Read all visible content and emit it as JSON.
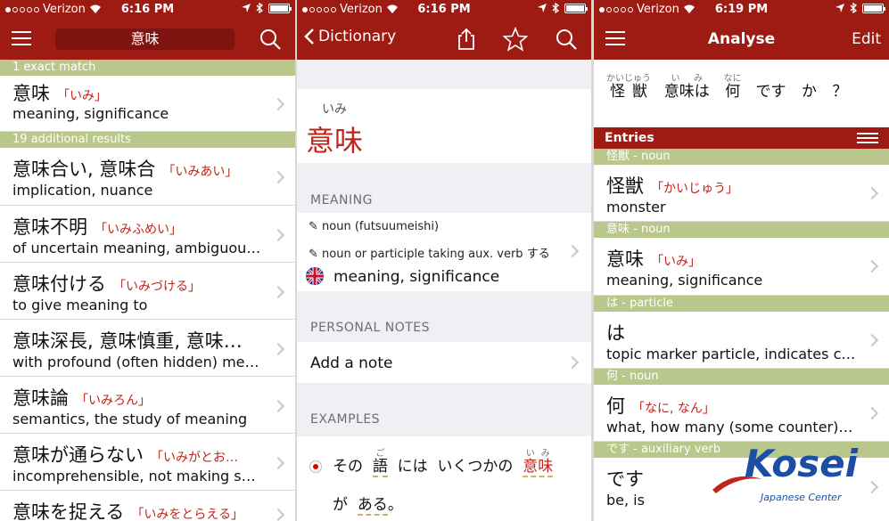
{
  "status_bars": [
    {
      "carrier": "Verizon",
      "time": "6:16 PM"
    },
    {
      "carrier": "Verizon",
      "time": "6:16 PM"
    },
    {
      "carrier": "Verizon",
      "time": "6:19 PM"
    }
  ],
  "colors": {
    "header": "#9e1b13",
    "section": "#b9c78c",
    "reading": "#c0241b",
    "accent_blue": "#1c4fa3"
  },
  "search_screen": {
    "search_value": "意味",
    "icons": {
      "menu": "hamburger-icon",
      "search": "search-icon"
    },
    "sections": [
      {
        "label": "1 exact match"
      },
      {
        "label": "19 additional results"
      }
    ],
    "results": [
      {
        "jp": "意味",
        "reading": "「いみ」",
        "en": "meaning, significance"
      },
      {
        "jp": "意味合い, 意味合",
        "reading": "「いみあい」",
        "en": "implication, nuance"
      },
      {
        "jp": "意味不明",
        "reading": "「いみふめい」",
        "en": "of uncertain meaning, ambiguou…"
      },
      {
        "jp": "意味付ける",
        "reading": "「いみづける」",
        "en": "to give meaning to"
      },
      {
        "jp": "意味深長, 意味慎重, 意味…",
        "reading": "",
        "en": "with profound (often hidden) me…"
      },
      {
        "jp": "意味論",
        "reading": "「いみろん」",
        "en": "semantics, the study of meaning"
      },
      {
        "jp": "意味が通らない",
        "reading": "「いみがとお…",
        "en": "incomprehensible, not making s…"
      },
      {
        "jp": "意味を捉える",
        "reading": "「いみをとらえる」",
        "en": ""
      }
    ]
  },
  "dictionary_screen": {
    "back_label": "Dictionary",
    "icons": {
      "back": "chevron-left-icon",
      "share": "share-icon",
      "favorite": "star-icon",
      "search": "search-icon"
    },
    "word_furigana": "いみ",
    "word": "意味",
    "meaning_header": "MEANING",
    "pos_lines": [
      "✎ noun (futsuumeishi)",
      "✎ noun or participle taking aux. verb する"
    ],
    "meaning": "meaning, significance",
    "notes_header": "PERSONAL NOTES",
    "add_note": "Add a note",
    "examples_header": "EXAMPLES",
    "example": {
      "w1": "その",
      "w2": "語",
      "w2_furi": "ご",
      "w3": "には",
      "w4": "いくつかの",
      "w5": "意味",
      "w5_furi": "いみ",
      "w6": "が",
      "w7": "ある",
      "w8": "。"
    }
  },
  "analyse_screen": {
    "title": "Analyse",
    "edit_label": "Edit",
    "sentence": [
      {
        "text": "怪獣",
        "furi": "かいじゅう"
      },
      {
        "text": "意味は",
        "furi": "いみ"
      },
      {
        "text": "何",
        "furi": "なに"
      },
      {
        "text": "です",
        "furi": ""
      },
      {
        "text": "か",
        "furi": ""
      },
      {
        "text": "？",
        "furi": ""
      }
    ],
    "entries_label": "Entries",
    "entries": [
      {
        "section": "怪獣 - noun",
        "jp": "怪獣",
        "reading": "「かいじゅう」",
        "en": "monster"
      },
      {
        "section": "意味 - noun",
        "jp": "意味",
        "reading": "「いみ」",
        "en": "meaning, significance"
      },
      {
        "section": "は - particle",
        "jp": "は",
        "reading": "",
        "en": "topic marker particle, indicates c…"
      },
      {
        "section": "何 - noun",
        "jp": "何",
        "reading": "「なに, なん」",
        "en": "what, how many (some counter),…"
      },
      {
        "section": "です - auxiliary verb",
        "jp": "です",
        "reading": "",
        "en": "be, is"
      }
    ]
  },
  "watermark": {
    "brand": "Kosei",
    "sub": "Japanese Center"
  }
}
